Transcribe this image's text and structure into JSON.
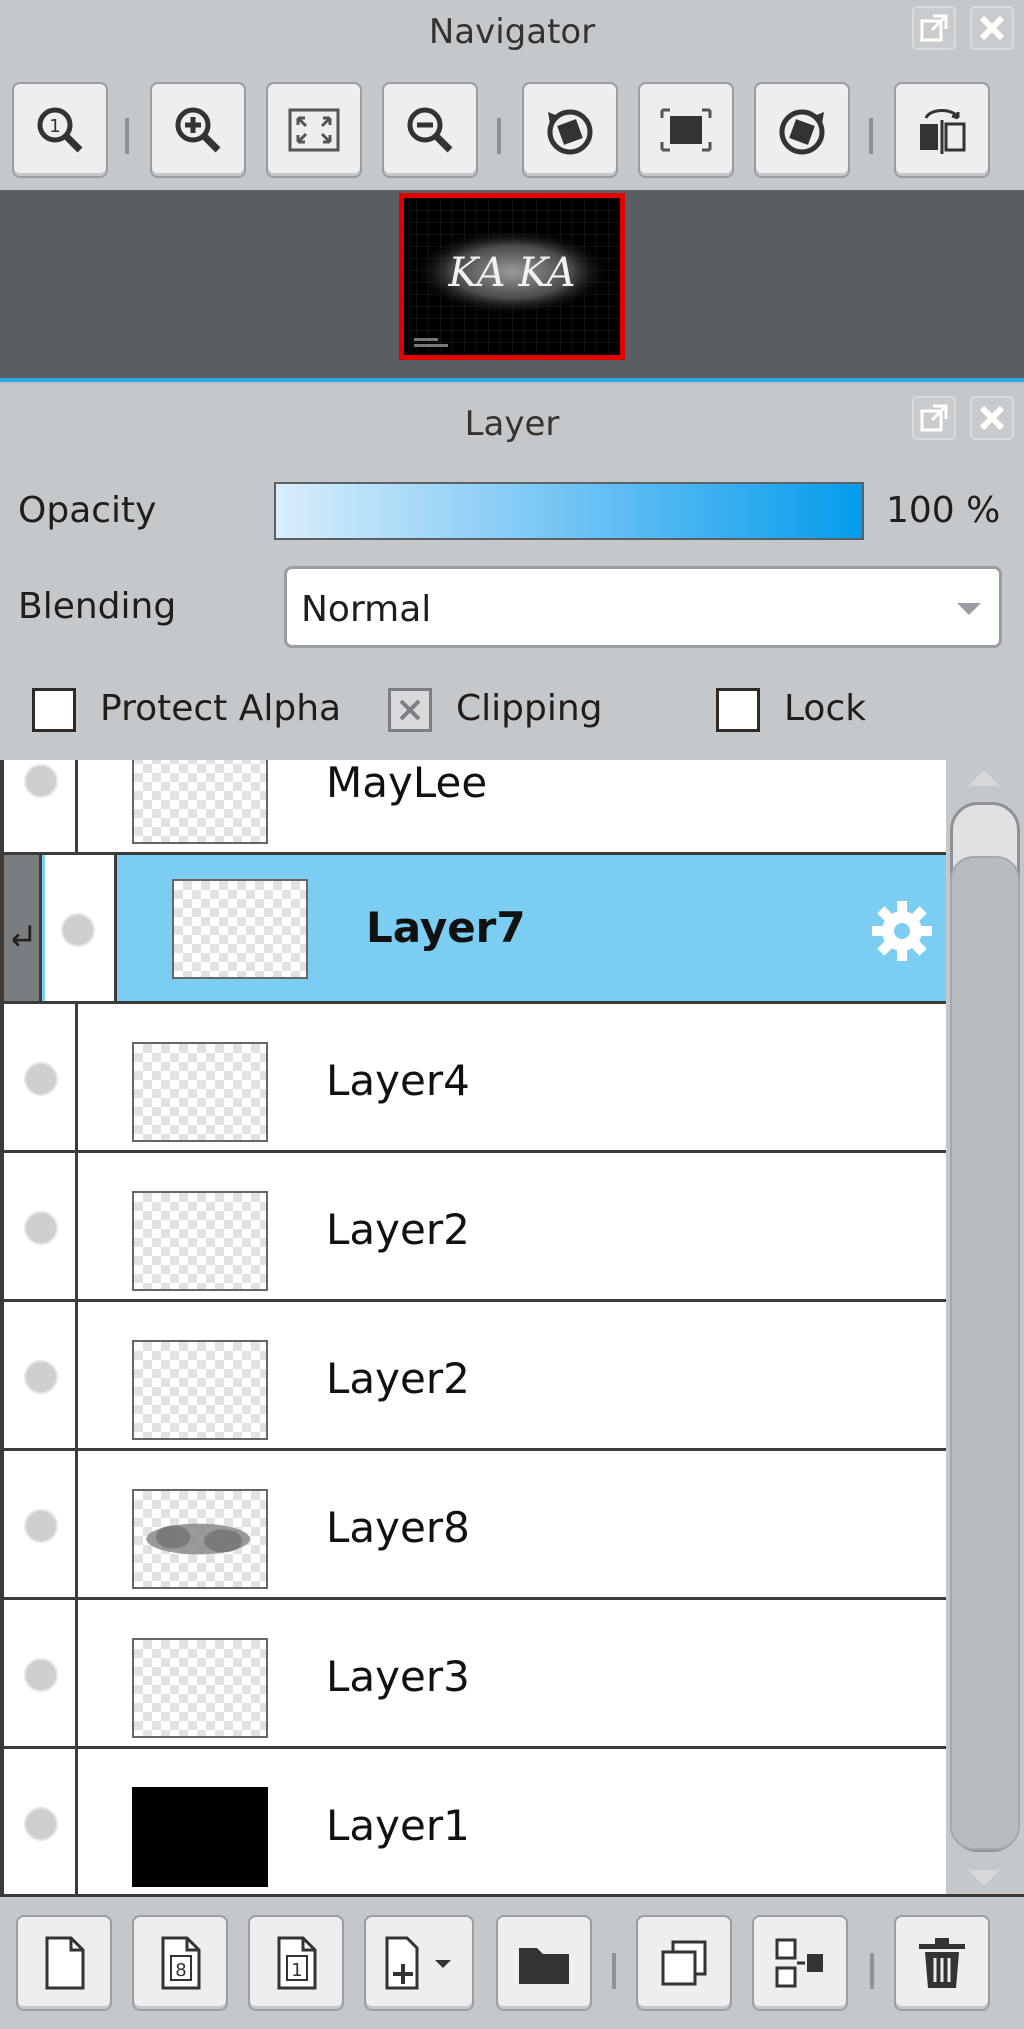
{
  "navigator": {
    "title": "Navigator",
    "thumbnail_text": "KA KA"
  },
  "layer_panel": {
    "title": "Layer",
    "opacity_label": "Opacity",
    "opacity_value": "100 %",
    "opacity_fraction": 1.0,
    "blending_label": "Blending",
    "blending_value": "Normal",
    "protect_alpha_label": "Protect Alpha",
    "clipping_label": "Clipping",
    "lock_label": "Lock",
    "layers": [
      {
        "name": "MayLee",
        "selected": false
      },
      {
        "name": "Layer7",
        "selected": true
      },
      {
        "name": "Layer4",
        "selected": false
      },
      {
        "name": "Layer2",
        "selected": false
      },
      {
        "name": "Layer2",
        "selected": false
      },
      {
        "name": "Layer8",
        "selected": false
      },
      {
        "name": "Layer3",
        "selected": false
      },
      {
        "name": "Layer1",
        "selected": false
      }
    ]
  },
  "colors": {
    "selected_row": "#7ccdf2",
    "accent_divider": "#2aa6e6",
    "navigator_frame": "#e30000"
  }
}
